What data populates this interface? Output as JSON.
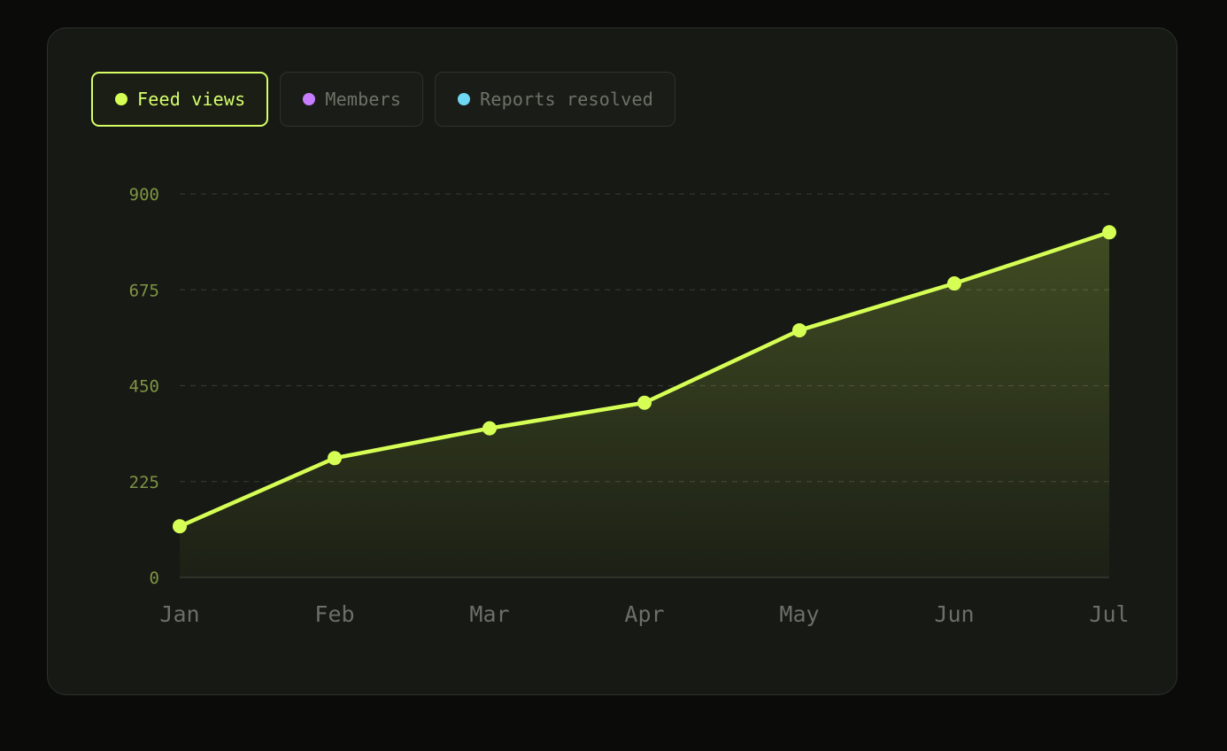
{
  "tabs": [
    {
      "label": "Feed views",
      "color": "#d6ff55",
      "active": true
    },
    {
      "label": "Members",
      "color": "#c77dff",
      "active": false
    },
    {
      "label": "Reports resolved",
      "color": "#6fd8f5",
      "active": false
    }
  ],
  "colors": {
    "accent": "#d6ff55",
    "grid": "#34372f",
    "y_tick": "#7f9444",
    "x_tick": "#6c6e68"
  },
  "chart_data": {
    "type": "area",
    "categories": [
      "Jan",
      "Feb",
      "Mar",
      "Apr",
      "May",
      "Jun",
      "Jul"
    ],
    "series": [
      {
        "name": "Feed views",
        "values": [
          120,
          280,
          350,
          410,
          580,
          690,
          810
        ]
      }
    ],
    "yticks": [
      "0",
      "225",
      "450",
      "675",
      "900"
    ],
    "ylim": [
      0,
      900
    ],
    "grid": true
  }
}
